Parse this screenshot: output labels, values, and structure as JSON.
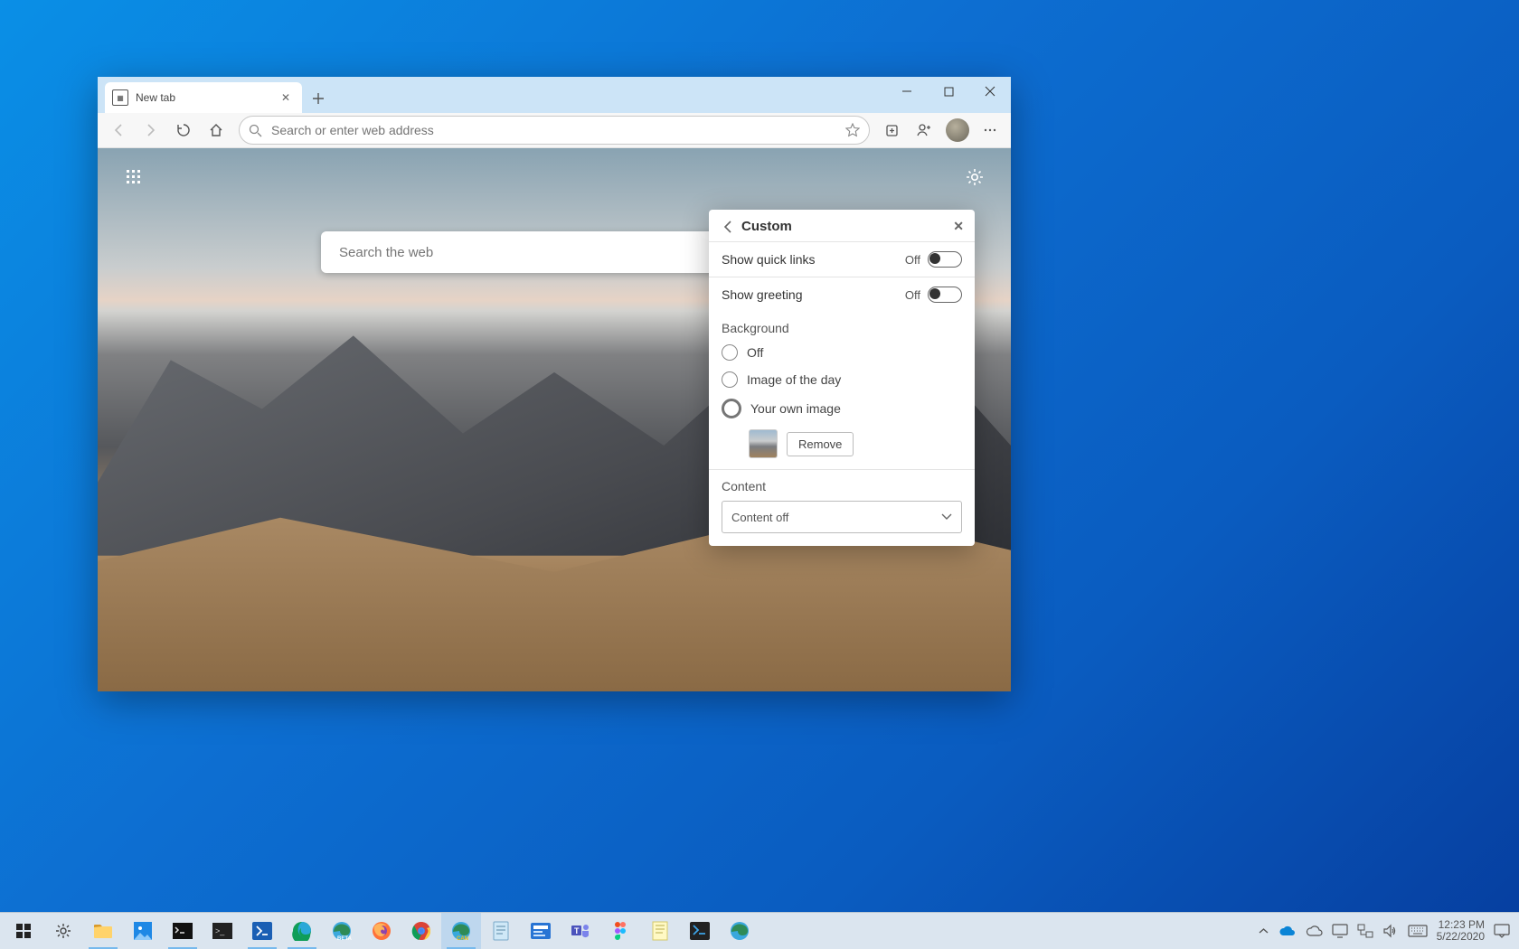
{
  "tab": {
    "title": "New tab"
  },
  "addressbar": {
    "placeholder": "Search or enter web address"
  },
  "ntp": {
    "search_placeholder": "Search the web"
  },
  "panel": {
    "title": "Custom",
    "quick_links_label": "Show quick links",
    "quick_links_state": "Off",
    "greeting_label": "Show greeting",
    "greeting_state": "Off",
    "background_heading": "Background",
    "bg_opt_off": "Off",
    "bg_opt_daily": "Image of the day",
    "bg_opt_own": "Your own image",
    "remove_button": "Remove",
    "content_heading": "Content",
    "content_value": "Content off"
  },
  "tray": {
    "time": "12:23 PM",
    "date": "5/22/2020"
  }
}
